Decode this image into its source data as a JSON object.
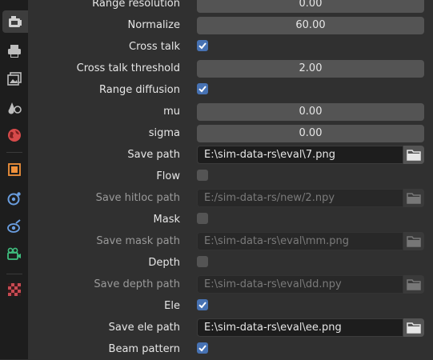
{
  "colors": {
    "accent": "#4772b3",
    "panel": "#303030",
    "sidebar": "#1d1d1d",
    "field": "#545454"
  },
  "sidebar": {
    "tabs": [
      {
        "icon": "tool-icon"
      },
      {
        "icon": "render-icon"
      },
      {
        "icon": "output-icon"
      },
      {
        "icon": "view-layer-icon"
      },
      {
        "icon": "scene-icon"
      },
      {
        "icon": "world-icon"
      },
      {
        "icon": "object-icon"
      },
      {
        "icon": "modifier-icon"
      },
      {
        "icon": "particles-icon"
      },
      {
        "icon": "physics-icon"
      },
      {
        "icon": "constraints-icon"
      },
      {
        "icon": "data-icon"
      },
      {
        "icon": "texture-icon"
      }
    ]
  },
  "props": {
    "range_resolution": {
      "label": "Range resolution",
      "value": "0.00"
    },
    "normalize": {
      "label": "Normalize",
      "value": "60.00"
    },
    "cross_talk": {
      "label": "Cross talk",
      "checked": true
    },
    "cross_talk_threshold": {
      "label": "Cross talk threshold",
      "value": "2.00"
    },
    "range_diffusion": {
      "label": "Range diffusion",
      "checked": true
    },
    "mu": {
      "label": "mu",
      "value": "0.00"
    },
    "sigma": {
      "label": "sigma",
      "value": "0.00"
    },
    "save_path": {
      "label": "Save path",
      "value": "E:\\sim-data-rs\\eval\\7.png"
    },
    "flow": {
      "label": "Flow",
      "checked": false
    },
    "save_hitloc_path": {
      "label": "Save hitloc path",
      "value": "E:/sim-data-rs/new/2.npy"
    },
    "mask": {
      "label": "Mask",
      "checked": false
    },
    "save_mask_path": {
      "label": "Save mask path",
      "value": "E:\\sim-data-rs\\eval\\mm.png"
    },
    "depth": {
      "label": "Depth",
      "checked": false
    },
    "save_depth_path": {
      "label": "Save depth path",
      "value": "E:\\sim-data-rs\\eval\\dd.npy"
    },
    "ele": {
      "label": "Ele",
      "checked": true
    },
    "save_ele_path": {
      "label": "Save ele path",
      "value": "E:\\sim-data-rs\\eval\\ee.png"
    },
    "beam_pattern": {
      "label": "Beam pattern",
      "checked": true
    }
  }
}
